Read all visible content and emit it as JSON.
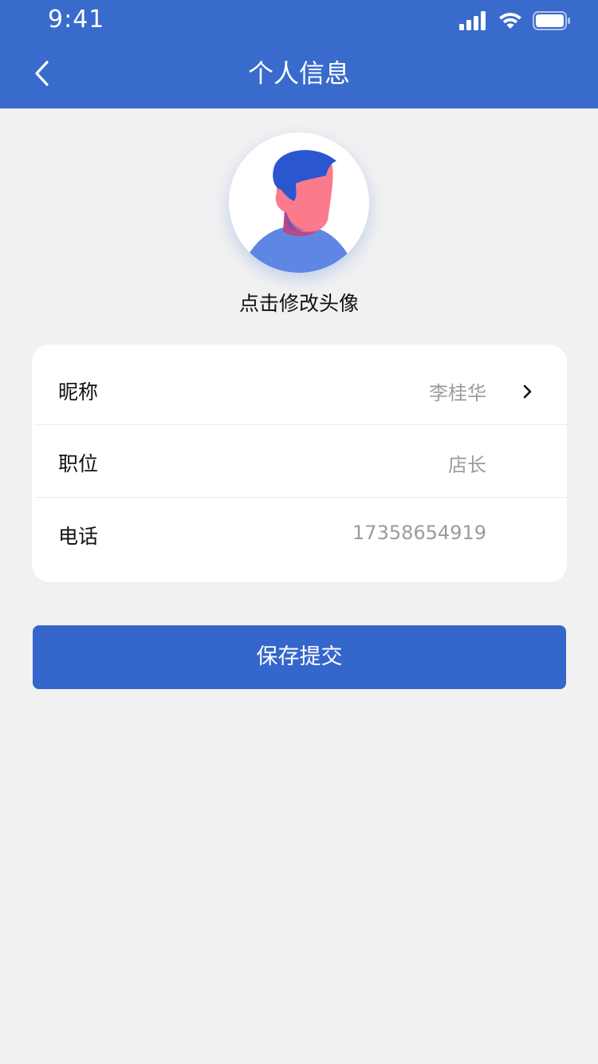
{
  "status_bar": {
    "time": "9:41"
  },
  "header": {
    "title": "个人信息"
  },
  "avatar": {
    "caption": "点击修改头像"
  },
  "profile": {
    "rows": [
      {
        "label": "昵称",
        "value": "李桂华"
      },
      {
        "label": "职位",
        "value": "店长"
      },
      {
        "label": "电话",
        "value": "17358654919"
      }
    ]
  },
  "actions": {
    "save_label": "保存提交"
  },
  "colors": {
    "primary": "#386bcc",
    "button": "#3466cc",
    "background": "#f1f1f2"
  },
  "icons": [
    "back-chevron-icon",
    "signal-icon",
    "wifi-icon",
    "battery-icon",
    "chevron-right-icon"
  ]
}
